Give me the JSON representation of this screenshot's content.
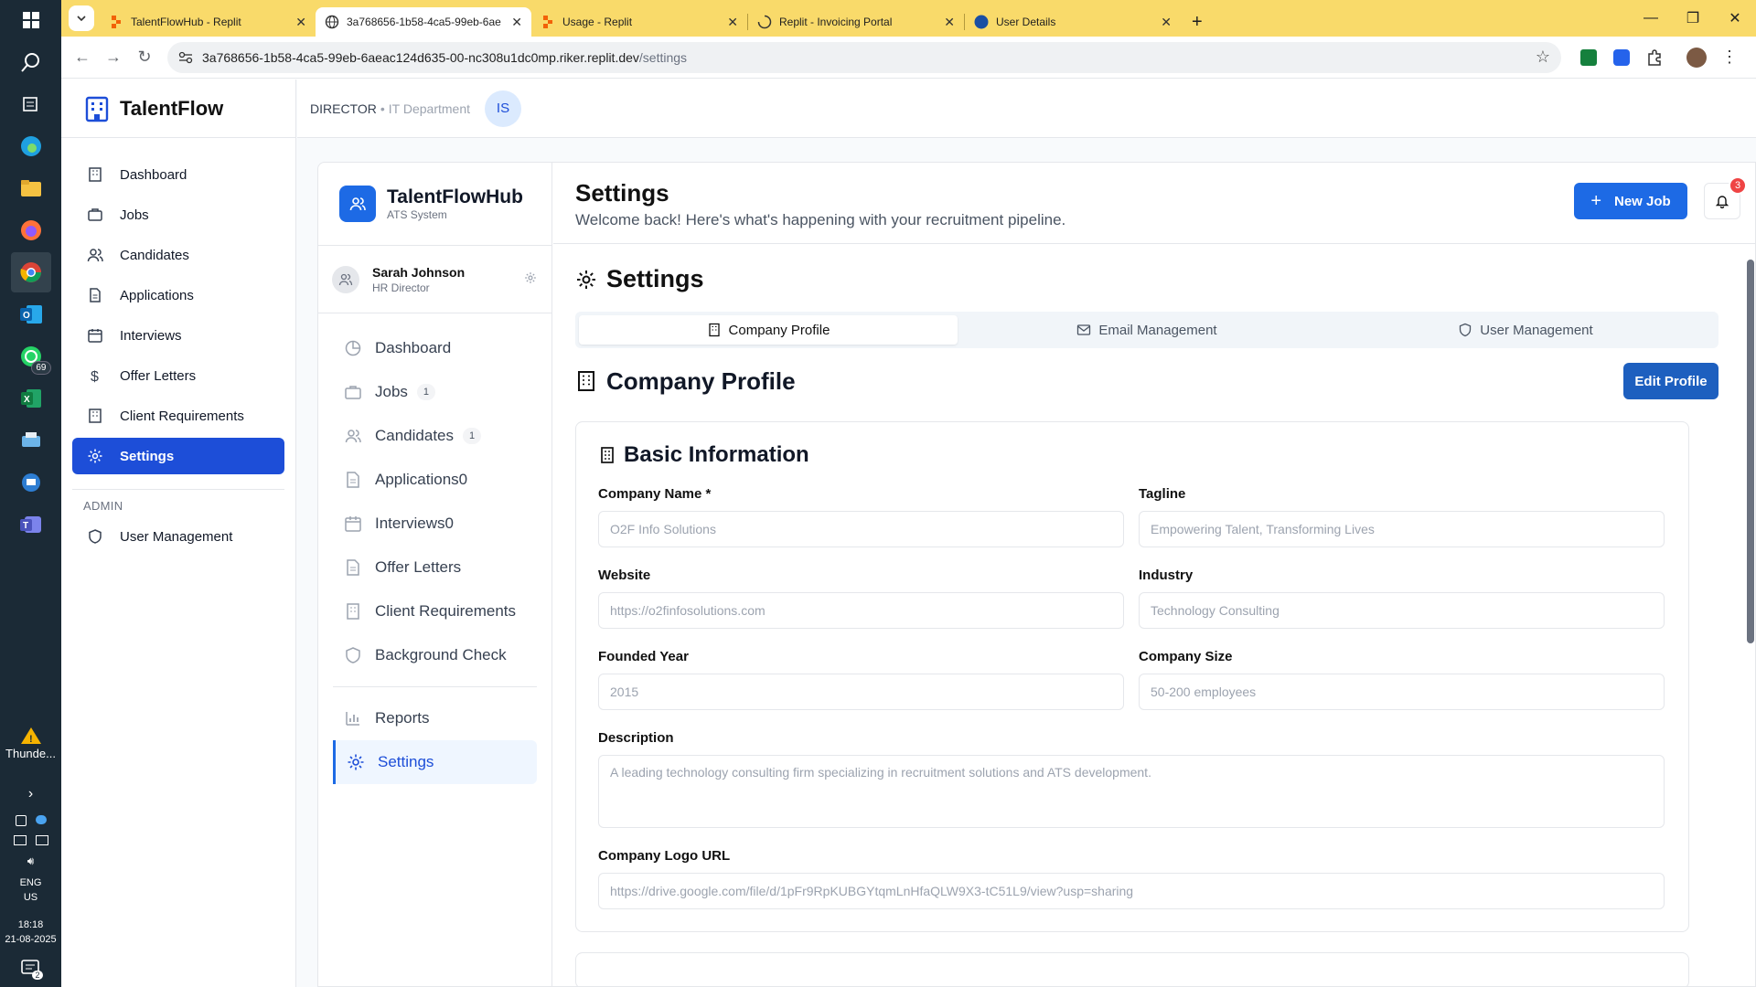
{
  "browser": {
    "tabs": [
      {
        "title": "TalentFlowHub - Replit",
        "active": false
      },
      {
        "title": "3a768656-1b58-4ca5-99eb-6ae",
        "active": true
      },
      {
        "title": "Usage - Replit",
        "active": false
      },
      {
        "title": "Replit - Invoicing Portal",
        "active": false
      },
      {
        "title": "User Details",
        "active": false
      }
    ],
    "new_tab": "+",
    "url_host": "3a768656-1b58-4ca5-99eb-6aeac124d635-00-nc308u1dc0mp.riker.replit.dev",
    "url_path": "/settings"
  },
  "taskbar": {
    "whatsapp_badge": "69",
    "weather_label": "Thunde...",
    "lang": "ENG",
    "region": "US",
    "time": "18:18",
    "date": "21-08-2025",
    "notif_count": "2"
  },
  "sidebar": {
    "brand": "TalentFlow",
    "items": [
      {
        "label": "Dashboard",
        "icon": "building-icon"
      },
      {
        "label": "Jobs",
        "icon": "briefcase-icon"
      },
      {
        "label": "Candidates",
        "icon": "users-icon"
      },
      {
        "label": "Applications",
        "icon": "file-icon"
      },
      {
        "label": "Interviews",
        "icon": "calendar-icon"
      },
      {
        "label": "Offer Letters",
        "icon": "dollar-icon"
      },
      {
        "label": "Client Requirements",
        "icon": "building-icon"
      },
      {
        "label": "Settings",
        "icon": "gear-icon",
        "active": true
      }
    ],
    "admin_heading": "ADMIN",
    "admin_items": [
      {
        "label": "User Management",
        "icon": "shield-icon"
      }
    ]
  },
  "topbar": {
    "role": "DIRECTOR",
    "separator": "•",
    "department": "IT Department",
    "avatar_initials": "IS"
  },
  "inner_sidebar": {
    "brand": "TalentFlowHub",
    "brand_sub": "ATS System",
    "user_name": "Sarah Johnson",
    "user_role": "HR Director",
    "items": [
      {
        "label": "Dashboard",
        "count": ""
      },
      {
        "label": "Jobs",
        "count": "1"
      },
      {
        "label": "Candidates",
        "count": "1"
      },
      {
        "label": "Applications0",
        "count": ""
      },
      {
        "label": "Interviews0",
        "count": ""
      },
      {
        "label": "Offer Letters",
        "count": ""
      },
      {
        "label": "Client Requirements",
        "count": ""
      },
      {
        "label": "Background Check",
        "count": ""
      }
    ],
    "bottom_items": [
      {
        "label": "Reports"
      },
      {
        "label": "Settings",
        "active": true
      }
    ]
  },
  "header": {
    "title": "Settings",
    "subtitle": "Welcome back! Here's what's happening with your recruitment pipeline.",
    "new_job": "New Job",
    "notif_count": "3"
  },
  "settings": {
    "title": "Settings",
    "tabs": [
      {
        "label": "Company Profile",
        "active": true
      },
      {
        "label": "Email Management",
        "active": false
      },
      {
        "label": "User Management",
        "active": false
      }
    ],
    "profile_title": "Company Profile",
    "edit_button": "Edit Profile",
    "basic_info_title": "Basic Information",
    "fields": {
      "company_name": {
        "label": "Company Name *",
        "placeholder": "O2F Info Solutions"
      },
      "tagline": {
        "label": "Tagline",
        "placeholder": "Empowering Talent, Transforming Lives"
      },
      "website": {
        "label": "Website",
        "placeholder": "https://o2finfosolutions.com"
      },
      "industry": {
        "label": "Industry",
        "placeholder": "Technology Consulting"
      },
      "founded": {
        "label": "Founded Year",
        "placeholder": "2015"
      },
      "size": {
        "label": "Company Size",
        "placeholder": "50-200 employees"
      },
      "description": {
        "label": "Description",
        "placeholder": "A leading technology consulting firm specializing in recruitment solutions and ATS development."
      },
      "logo_url": {
        "label": "Company Logo URL",
        "placeholder": "https://drive.google.com/file/d/1pFr9RpKUBGYtqmLnHfaQLW9X3-tC51L9/view?usp=sharing"
      }
    }
  }
}
